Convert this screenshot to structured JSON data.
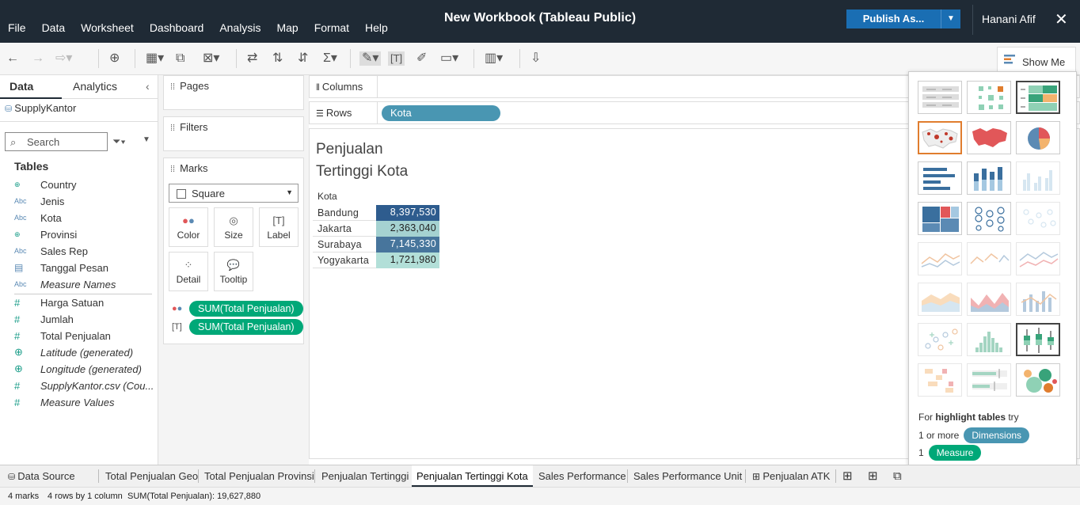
{
  "window": {
    "title": "New Workbook (Tableau Public)",
    "user": "Hanani Afif",
    "publish_label": "Publish As..."
  },
  "menu": [
    "File",
    "Data",
    "Worksheet",
    "Dashboard",
    "Analysis",
    "Map",
    "Format",
    "Help"
  ],
  "toolbar": {
    "show_me_label": "Show Me"
  },
  "data_pane": {
    "tab_data": "Data",
    "tab_analytics": "Analytics",
    "datasource": "SupplyKantor",
    "search_placeholder": "Search",
    "tables_label": "Tables",
    "dimensions": [
      {
        "icon": "geo",
        "name": "Country"
      },
      {
        "icon": "Abc",
        "name": "Jenis"
      },
      {
        "icon": "Abc",
        "name": "Kota"
      },
      {
        "icon": "geo",
        "name": "Provinsi"
      },
      {
        "icon": "Abc",
        "name": "Sales Rep"
      },
      {
        "icon": "date",
        "name": "Tanggal Pesan"
      },
      {
        "icon": "Abc",
        "name": "Measure Names"
      }
    ],
    "measures": [
      {
        "icon": "#",
        "name": "Harga Satuan"
      },
      {
        "icon": "#",
        "name": "Jumlah"
      },
      {
        "icon": "#",
        "name": "Total Penjualan"
      },
      {
        "icon": "geo",
        "name": "Latitude (generated)"
      },
      {
        "icon": "geo",
        "name": "Longitude (generated)"
      },
      {
        "icon": "#",
        "name": "SupplyKantor.csv (Cou..."
      },
      {
        "icon": "#",
        "name": "Measure Values"
      }
    ]
  },
  "cards": {
    "pages_label": "Pages",
    "filters_label": "Filters",
    "marks_label": "Marks",
    "mark_type": "Square",
    "buttons": {
      "color": "Color",
      "size": "Size",
      "label": "Label",
      "detail": "Detail",
      "tooltip": "Tooltip"
    },
    "pills": [
      "SUM(Total Penjualan)",
      "SUM(Total Penjualan)"
    ]
  },
  "shelves": {
    "columns_label": "Columns",
    "rows_label": "Rows",
    "rows_pill": "Kota"
  },
  "viz": {
    "title_line1": "Penjualan",
    "title_line2": "Tertinggi Kota",
    "column_header": "Kota"
  },
  "chart_data": {
    "type": "table",
    "title": "Penjualan Tertinggi Kota",
    "categories": [
      "Bandung",
      "Jakarta",
      "Surabaya",
      "Yogyakarta"
    ],
    "values": [
      8397530,
      2363040,
      7145330,
      1721980
    ],
    "labels": [
      "8,397,530",
      "2,363,040",
      "7,145,330",
      "1,721,980"
    ],
    "color_scale": {
      "low": "#b2dfd8",
      "high": "#2e5c8e"
    }
  },
  "show_me": {
    "hint_prefix": "For ",
    "hint_bold": "highlight tables",
    "hint_suffix": " try",
    "dim_req": "1 or more",
    "dim_label": "Dimensions",
    "meas_req": "1",
    "meas_label": "Measure",
    "colors": {
      "dim": "#4996b2",
      "meas": "#00a878"
    }
  },
  "sheet_tabs": [
    "Data Source",
    "Total Penjualan Geo",
    "Total Penjualan Provinsi",
    "Penjualan Tertinggi",
    "Penjualan Tertinggi Kota",
    "Sales Performance",
    "Sales Performance Unit",
    "Penjualan ATK"
  ],
  "status": {
    "marks": "4 marks",
    "rows": "4 rows by 1 column",
    "sum": "SUM(Total Penjualan): 19,627,880"
  }
}
